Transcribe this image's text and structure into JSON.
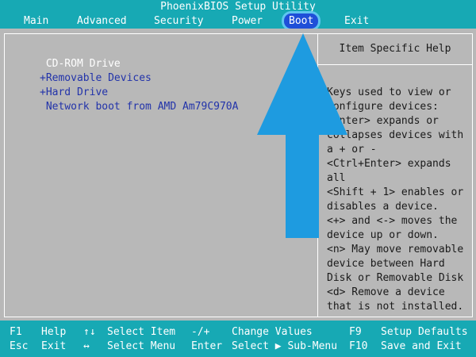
{
  "topbar": {
    "title": "PhoenixBIOS Setup Utility",
    "menu": [
      "Main",
      "Advanced",
      "Security",
      "Power",
      "Boot",
      "Exit"
    ],
    "active": "Boot"
  },
  "boot_list": [
    {
      "label": " CD-ROM Drive",
      "selected": true
    },
    {
      "label": "+Removable Devices",
      "selected": false
    },
    {
      "label": "+Hard Drive",
      "selected": false
    },
    {
      "label": " Network boot from AMD Am79C970A",
      "selected": false
    }
  ],
  "help": {
    "header": "Item Specific Help",
    "lines": [
      "Keys used to view or",
      "configure devices:",
      "<Enter> expands or",
      "collapses devices with",
      "a + or -",
      "<Ctrl+Enter> expands",
      "all",
      "<Shift + 1> enables or",
      "disables a device.",
      "<+> and <-> moves the",
      "device up or down.",
      "<n> May move removable",
      "device between Hard",
      "Disk or Removable Disk",
      "<d> Remove a device",
      "that is not installed."
    ]
  },
  "footer": {
    "row1": [
      {
        "key": "F1",
        "desc": "Help"
      },
      {
        "key": "↑↓",
        "desc": "Select Item"
      },
      {
        "key": "-/+",
        "desc": "Change Values"
      },
      {
        "key": "F9",
        "desc": "Setup Defaults"
      }
    ],
    "row2": [
      {
        "key": "Esc",
        "desc": "Exit"
      },
      {
        "key": "↔",
        "desc": "Select Menu"
      },
      {
        "key": "Enter",
        "desc": "Select ▶ Sub-Menu"
      },
      {
        "key": "F10",
        "desc": "Save and Exit"
      }
    ]
  },
  "annotation": {
    "arrow_color": "#1e9be0",
    "icon": "up-arrow-icon"
  }
}
